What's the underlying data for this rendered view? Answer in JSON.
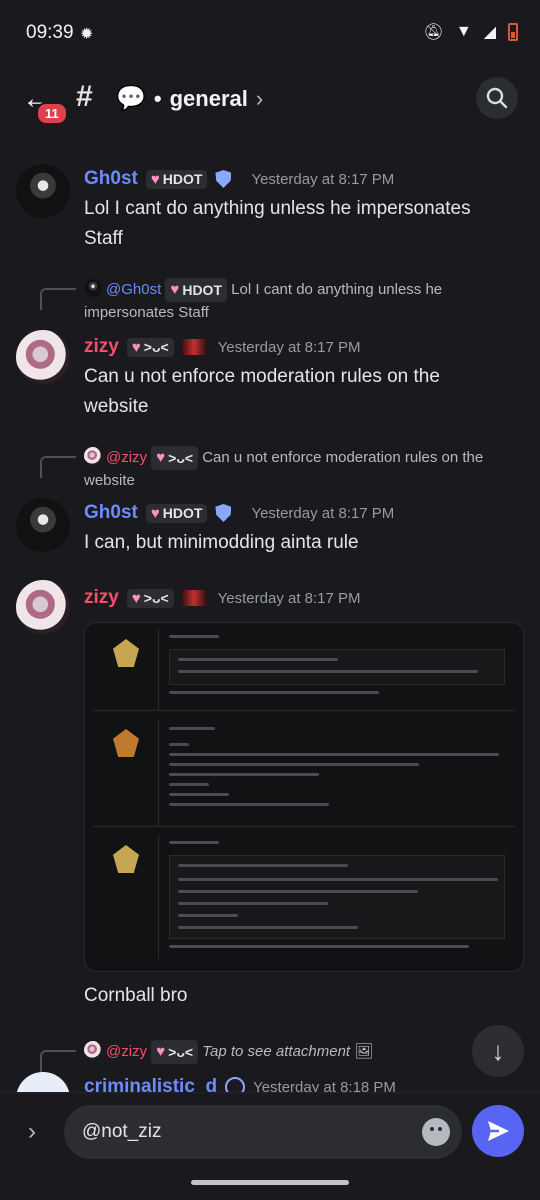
{
  "status": {
    "time": "09:39"
  },
  "header": {
    "unread_count": "11",
    "channel_name": "general"
  },
  "messages": [
    {
      "author": "Gh0st",
      "tag": "HDOT",
      "timestamp": "Yesterday at 8:17 PM",
      "text": "Lol I cant do anything unless he impersonates Staff"
    },
    {
      "reply_author": "@Gh0st",
      "reply_tag": "HDOT",
      "reply_text": "Lol I cant do anything unless he impersonates Staff",
      "author": "zizy",
      "tag": "˃ᴗ˂",
      "timestamp": "Yesterday at 8:17 PM",
      "text": "Can u not enforce moderation rules on the website"
    },
    {
      "reply_author": "@zizy",
      "reply_tag": "˃ᴗ˂",
      "reply_text": "Can u not enforce moderation rules on the website",
      "author": "Gh0st",
      "tag": "HDOT",
      "timestamp": "Yesterday at 8:17 PM",
      "text": "I can, but minimodding ainta rule"
    },
    {
      "author": "zizy",
      "tag": "˃ᴗ˂",
      "timestamp": "Yesterday at 8:17 PM",
      "text": "Cornball bro"
    },
    {
      "reply_author": "@zizy",
      "reply_tag": "˃ᴗ˂",
      "reply_text": "Tap to see attachment",
      "author": "criminalistic_d",
      "timestamp": "Yesterday at 8:18 PM"
    }
  ],
  "input": {
    "value": "@not_ziz"
  }
}
